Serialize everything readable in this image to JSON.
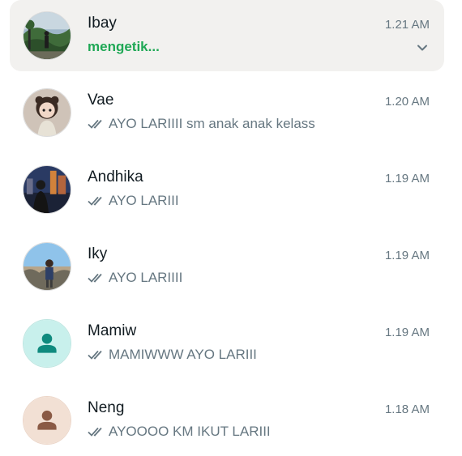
{
  "chats": [
    {
      "name": "Ibay",
      "time": "1.21 AM",
      "preview": "mengetik...",
      "typing": true,
      "avatar": "photo-landscape"
    },
    {
      "name": "Vae",
      "time": "1.20 AM",
      "preview": "AYO LARIIII sm anak anak kelass",
      "typing": false,
      "avatar": "photo-doll"
    },
    {
      "name": "Andhika",
      "time": "1.19 AM",
      "preview": "AYO LARIII",
      "typing": false,
      "avatar": "photo-city"
    },
    {
      "name": "Iky",
      "time": "1.19 AM",
      "preview": "AYO LARIIII",
      "typing": false,
      "avatar": "photo-beach"
    },
    {
      "name": "Mamiw",
      "time": "1.19 AM",
      "preview": "MAMIWWW AYO LARIII",
      "typing": false,
      "avatar": "default-person-icon"
    },
    {
      "name": "Neng",
      "time": "1.18 AM",
      "preview": "AYOOOO KM IKUT LARIII",
      "typing": false,
      "avatar": "default-person-icon"
    }
  ],
  "colors": {
    "typing": "#1fa855",
    "muted": "#667781",
    "active_row": "#f2f1ef",
    "mamiw_avatar_bg": "#c8f0ec",
    "mamiw_avatar_fg": "#0f8a7e",
    "neng_avatar_bg": "#f2e0d4",
    "neng_avatar_fg": "#8a5a45"
  }
}
